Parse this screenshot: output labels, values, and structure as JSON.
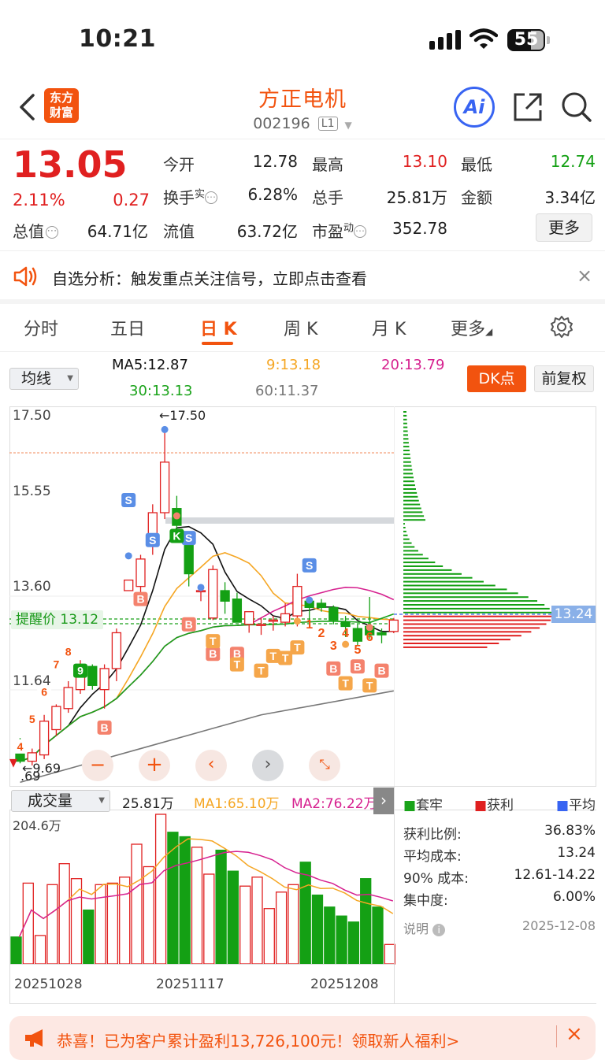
{
  "status_bar": {
    "time": "10:21",
    "battery": "55"
  },
  "header": {
    "logo_text_1": "东方",
    "logo_text_2": "财富",
    "stock_name": "方正电机",
    "stock_code": "002196",
    "level_badge": "L1",
    "ai_label": "Ai"
  },
  "quote": {
    "price": "13.05",
    "change_pct": "2.11%",
    "change": "0.27",
    "open_label": "今开",
    "open": "12.78",
    "high_label": "最高",
    "high": "13.10",
    "low_label": "最低",
    "low": "12.74",
    "turnover_label": "换手",
    "turnover_sup": "实",
    "turnover": "6.28%",
    "volume_label": "总手",
    "volume": "25.81万",
    "amount_label": "金额",
    "amount": "3.34亿",
    "mktcap_label": "总值",
    "mktcap": "64.71亿",
    "float_label": "流值",
    "float": "63.72亿",
    "pe_label": "市盈",
    "pe_sup": "动",
    "pe": "352.78",
    "more_button": "更多"
  },
  "notice": {
    "text": "自选分析：触发重点关注信号，立即点击查看"
  },
  "tabs": [
    {
      "label": "分时",
      "active": false
    },
    {
      "label": "五日",
      "active": false
    },
    {
      "label": "日 K",
      "active": true
    },
    {
      "label": "周 K",
      "active": false
    },
    {
      "label": "月 K",
      "active": false
    },
    {
      "label": "更多",
      "active": false
    }
  ],
  "indicators": {
    "ma_select": "均线",
    "ma5": "MA5:12.87",
    "ma9": "9:13.18",
    "ma20": "20:13.79",
    "ma30": "30:13.13",
    "ma60": "60:11.37",
    "dk_button": "DK点",
    "adjust_button": "前复权"
  },
  "colors": {
    "accent": "#f2530f",
    "up": "#e02020",
    "down": "#14a014",
    "ma5": "#111111",
    "ma9": "#f5a623",
    "ma20": "#d6218f",
    "ma30": "#1aa31a",
    "ma60": "#777777"
  },
  "kline": {
    "y_labels": [
      "17.50",
      "15.55",
      "13.60",
      "11.64"
    ],
    "high_marker": "←17.50",
    "low_marker_1": "←9.69",
    "low_marker_2": ".69",
    "alert_price": "提醒价 13.12",
    "chip_avg_price": "13.24"
  },
  "chart_data": {
    "type": "candlestick",
    "ylim": [
      9.3,
      17.9
    ],
    "candles": [
      {
        "o": 9.9,
        "h": 10.25,
        "l": 9.65,
        "c": 9.7
      },
      {
        "o": 9.7,
        "h": 10.0,
        "l": 9.6,
        "c": 9.9
      },
      {
        "o": 9.85,
        "h": 10.8,
        "l": 9.75,
        "c": 10.65
      },
      {
        "o": 10.45,
        "h": 11.05,
        "l": 10.3,
        "c": 11.0
      },
      {
        "o": 10.95,
        "h": 11.6,
        "l": 10.85,
        "c": 11.45
      },
      {
        "o": 11.4,
        "h": 12.1,
        "l": 11.3,
        "c": 11.85
      },
      {
        "o": 11.95,
        "h": 12.0,
        "l": 11.4,
        "c": 11.5
      },
      {
        "o": 11.4,
        "h": 12.0,
        "l": 10.95,
        "c": 11.9
      },
      {
        "o": 11.9,
        "h": 12.85,
        "l": 11.6,
        "c": 12.75
      },
      {
        "o": 13.75,
        "h": 14.0,
        "l": 13.75,
        "c": 14.0
      },
      {
        "o": 13.85,
        "h": 14.6,
        "l": 13.55,
        "c": 14.5
      },
      {
        "o": 14.8,
        "h": 15.8,
        "l": 14.6,
        "c": 15.6
      },
      {
        "o": 15.6,
        "h": 17.5,
        "l": 15.45,
        "c": 16.8
      },
      {
        "o": 15.7,
        "h": 16.0,
        "l": 15.2,
        "c": 15.3
      },
      {
        "o": 14.95,
        "h": 15.1,
        "l": 13.85,
        "c": 14.15
      },
      {
        "o": 13.75,
        "h": 13.9,
        "l": 13.5,
        "c": 13.75
      },
      {
        "o": 13.1,
        "h": 14.35,
        "l": 13.05,
        "c": 14.25
      },
      {
        "o": 13.75,
        "h": 13.95,
        "l": 13.2,
        "c": 13.5
      },
      {
        "o": 13.55,
        "h": 13.7,
        "l": 13.0,
        "c": 13.0
      },
      {
        "o": 12.95,
        "h": 13.2,
        "l": 12.75,
        "c": 13.25
      },
      {
        "o": 12.95,
        "h": 13.1,
        "l": 12.7,
        "c": 12.95
      },
      {
        "o": 13.05,
        "h": 13.15,
        "l": 12.8,
        "c": 13.05
      },
      {
        "o": 13.0,
        "h": 13.45,
        "l": 12.9,
        "c": 13.2
      },
      {
        "o": 13.15,
        "h": 14.15,
        "l": 12.9,
        "c": 13.85
      },
      {
        "o": 13.5,
        "h": 13.6,
        "l": 13.05,
        "c": 13.35
      },
      {
        "o": 13.45,
        "h": 13.55,
        "l": 13.25,
        "c": 13.35
      },
      {
        "o": 13.35,
        "h": 13.4,
        "l": 12.95,
        "c": 13.05
      },
      {
        "o": 13.0,
        "h": 13.15,
        "l": 12.65,
        "c": 12.9
      },
      {
        "o": 12.85,
        "h": 12.95,
        "l": 12.45,
        "c": 12.55
      },
      {
        "o": 12.9,
        "h": 13.6,
        "l": 12.6,
        "c": 12.7
      },
      {
        "o": 12.75,
        "h": 12.85,
        "l": 12.5,
        "c": 12.7
      },
      {
        "o": 12.78,
        "h": 13.1,
        "l": 12.74,
        "c": 13.05
      }
    ],
    "volume_legend": {
      "select": "成交量",
      "vol": "25.81万",
      "ma1": "MA1:65.10万",
      "ma2": "MA2:76.22万"
    },
    "volume_y_label": "204.6万",
    "volume_rel": [
      0.18,
      0.54,
      0.19,
      0.53,
      0.67,
      0.57,
      0.36,
      0.53,
      0.54,
      0.58,
      0.8,
      0.65,
      1.0,
      0.88,
      0.85,
      0.78,
      0.6,
      0.76,
      0.62,
      0.52,
      0.58,
      0.37,
      0.48,
      0.53,
      0.68,
      0.46,
      0.38,
      0.32,
      0.28,
      0.57,
      0.38,
      0.13
    ],
    "x_labels": [
      "20251028",
      "20251117",
      "20251208"
    ]
  },
  "chip": {
    "legend": [
      "套牢",
      "获利",
      "平均"
    ],
    "rows": [
      {
        "label": "获利比例:",
        "value": "36.83%"
      },
      {
        "label": "平均成本:",
        "value": "13.24"
      },
      {
        "label": "90% 成本:",
        "value": "12.61-14.22"
      },
      {
        "label": "集中度:",
        "value": "6.00%"
      }
    ],
    "note_label": "说明",
    "date": "2025-12-08"
  },
  "banner": {
    "text": "恭喜！已为客户累计盈利13,726,100元！领取新人福利>"
  }
}
